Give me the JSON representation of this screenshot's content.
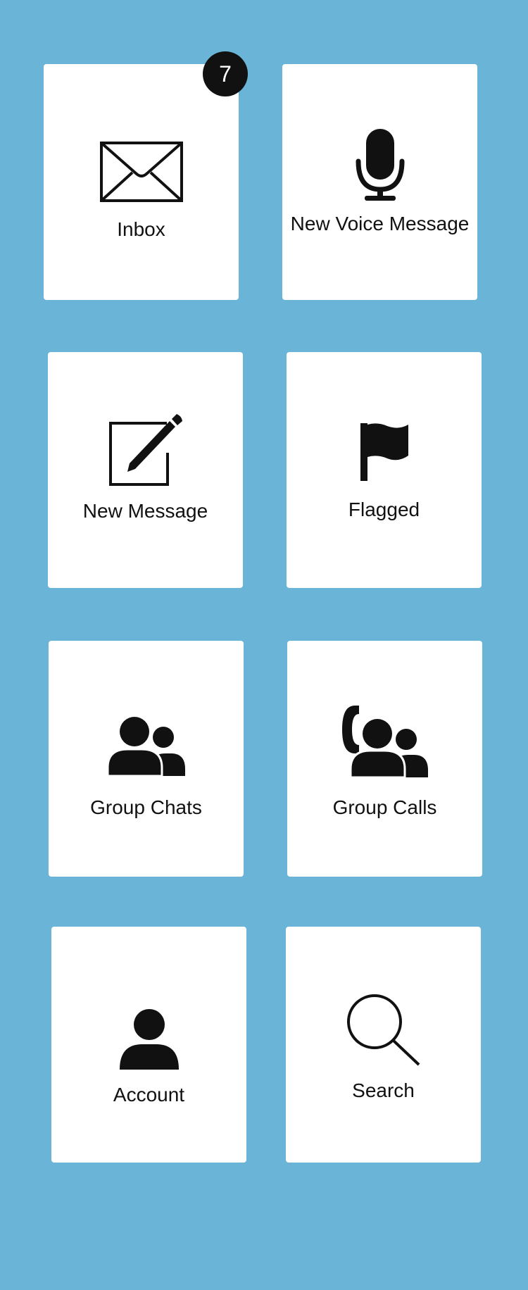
{
  "colors": {
    "background": "#6ab4d7",
    "tile": "#ffffff",
    "icon": "#111111",
    "badge": "#111111",
    "badge_text": "#ffffff"
  },
  "tiles": {
    "inbox": {
      "label": "Inbox",
      "icon": "envelope-icon",
      "badge": "7"
    },
    "new_voice_message": {
      "label": "New Voice Message",
      "icon": "microphone-icon"
    },
    "new_message": {
      "label": "New Message",
      "icon": "compose-icon"
    },
    "flagged": {
      "label": "Flagged",
      "icon": "flag-icon"
    },
    "group_chats": {
      "label": "Group Chats",
      "icon": "group-icon"
    },
    "group_calls": {
      "label": "Group Calls",
      "icon": "group-call-icon"
    },
    "account": {
      "label": "Account",
      "icon": "person-icon"
    },
    "search": {
      "label": "Search",
      "icon": "search-icon"
    }
  }
}
